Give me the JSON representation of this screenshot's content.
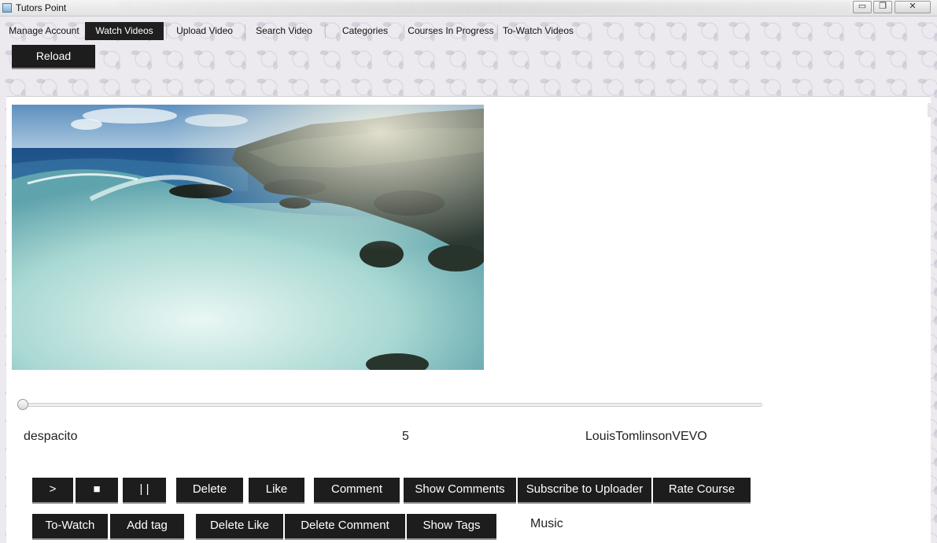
{
  "window": {
    "title": "Tutors Point",
    "buttons": {
      "minimize": "▭",
      "restore": "❐",
      "close": "✕"
    }
  },
  "menu": {
    "tabs": [
      {
        "label": "Manage Account"
      },
      {
        "label": "Watch Videos"
      },
      {
        "label": "Upload Video"
      },
      {
        "label": "Search Video"
      },
      {
        "label": "Categories"
      },
      {
        "label": "Courses In Progress"
      },
      {
        "label": "To-Watch Videos"
      }
    ],
    "active_tab": "Watch Videos"
  },
  "toolbar": {
    "reload_label": "Reload"
  },
  "player": {
    "progress": 0,
    "title": "despacito",
    "rating": "5",
    "uploader": "LouisTomlinsonVEVO",
    "category": "Music"
  },
  "controls": {
    "play": ">",
    "stop": "■",
    "pause": "| |",
    "delete": "Delete",
    "like": "Like",
    "comment": "Comment",
    "show_comments": "Show Comments",
    "subscribe": "Subscribe to Uploader",
    "rate_course": "Rate Course",
    "to_watch": "To-Watch",
    "add_tag": "Add tag",
    "delete_like": "Delete Like",
    "delete_comment": "Delete Comment",
    "show_tags": "Show Tags"
  },
  "colors": {
    "button_bg": "#1d1d1d",
    "button_text": "#ffffff",
    "active_tab_bg": "#1f1f1f"
  }
}
